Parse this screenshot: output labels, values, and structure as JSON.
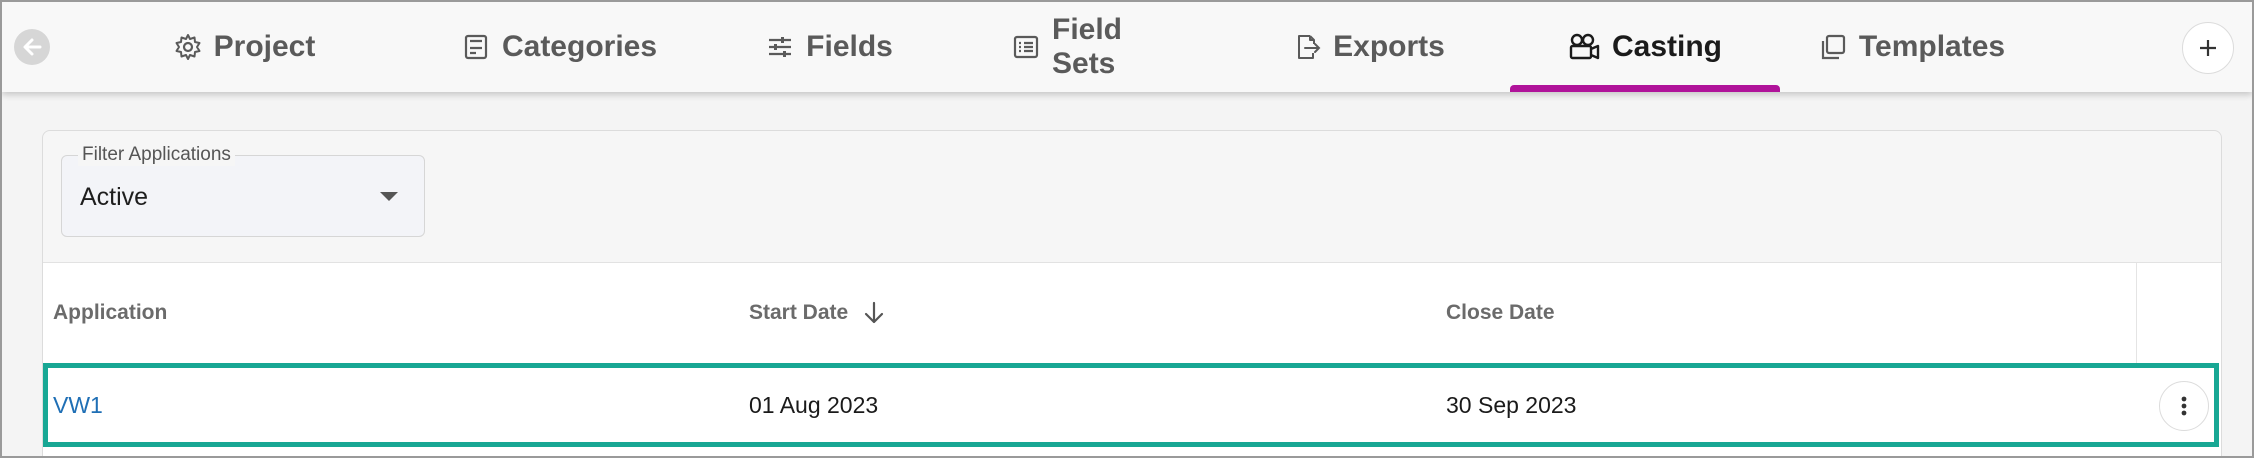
{
  "tabs": [
    {
      "label": "Project",
      "icon": "gear-icon",
      "active": false
    },
    {
      "label": "Categories",
      "icon": "categories-icon",
      "active": false
    },
    {
      "label": "Fields",
      "icon": "sliders-icon",
      "active": false
    },
    {
      "label": "Field Sets",
      "icon": "list-icon",
      "active": false
    },
    {
      "label": "Exports",
      "icon": "export-icon",
      "active": false
    },
    {
      "label": "Casting",
      "icon": "camera-icon",
      "active": true
    },
    {
      "label": "Templates",
      "icon": "templates-icon",
      "active": false
    }
  ],
  "colors": {
    "active_tab_underline": "#b0139a",
    "row_highlight": "#18a794",
    "link": "#1f6fb5"
  },
  "filter": {
    "label": "Filter Applications",
    "value": "Active"
  },
  "table": {
    "columns": [
      "Application",
      "Start Date",
      "Close Date"
    ],
    "sorted_column": "Start Date",
    "sort_direction": "descending",
    "rows": [
      {
        "application": "VW1",
        "start_date": "01 Aug 2023",
        "close_date": "30 Sep 2023"
      }
    ]
  }
}
